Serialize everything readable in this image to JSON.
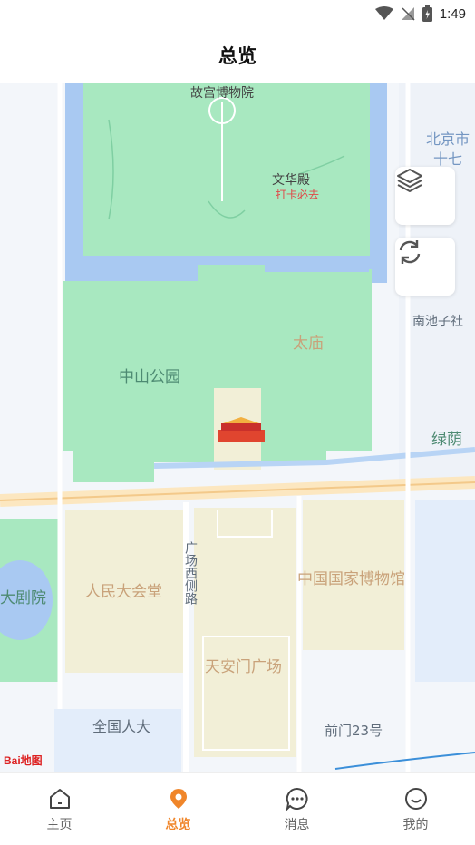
{
  "status_bar": {
    "time": "1:49"
  },
  "header": {
    "title": "总览"
  },
  "map": {
    "labels": {
      "palace_museum": "故宫博物院",
      "beijing_city": "北京市",
      "seventeen": "十七",
      "wenhua_hall": "文华殿",
      "must_visit": "打卡必去",
      "nanchizi": "南池子社",
      "taimiao": "太庙",
      "zhongshan_park": "中山公园",
      "lvyin": "绿荫",
      "grand_theatre": "大剧院",
      "great_hall": "人民大会堂",
      "guangchang_west": "广场西侧路",
      "national_museum": "中国国家博物馆",
      "tiananmen_square": "天安门广场",
      "npc": "全国人大",
      "qianmen23": "前门23号",
      "baidu_logo": "Bai地图"
    },
    "buttons": {
      "layers_icon": "layers-icon",
      "refresh_icon": "refresh-icon"
    }
  },
  "tabbar": {
    "items": [
      {
        "label": "主页",
        "icon": "home-icon",
        "active": false
      },
      {
        "label": "总览",
        "icon": "location-pin-icon",
        "active": true
      },
      {
        "label": "消息",
        "icon": "chat-icon",
        "active": false
      },
      {
        "label": "我的",
        "icon": "smile-icon",
        "active": false
      }
    ]
  },
  "colors": {
    "accent": "#f0862a",
    "park_green": "#a8e8c0",
    "water_blue": "#a9c9f2",
    "square_tan": "#f2efd7"
  }
}
